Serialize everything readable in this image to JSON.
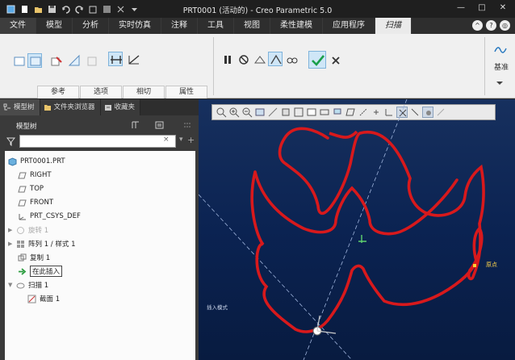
{
  "window": {
    "title": "PRT0001 (活动的) - Creo Parametric 5.0",
    "buttons": [
      "—",
      "□",
      "✕"
    ]
  },
  "ribbon_tabs": [
    "文件",
    "模型",
    "分析",
    "实时仿真",
    "注释",
    "工具",
    "视图",
    "柔性建模",
    "应用程序",
    "扫描"
  ],
  "ribbon": {
    "panel_tabs": [
      "参考",
      "选项",
      "相切",
      "属性"
    ],
    "right_label": "基准"
  },
  "left_panel": {
    "tabs": [
      "模型树",
      "文件夹浏览器",
      "收藏夹"
    ],
    "tree_label": "模型树",
    "filter": {
      "value": "",
      "placeholder": ""
    },
    "nodes": {
      "root": "PRT0001.PRT",
      "right": "RIGHT",
      "top": "TOP",
      "front": "FRONT",
      "csys": "PRT_CSYS_DEF",
      "rotate": "旋转 1",
      "pattern": "阵列 1 / 样式 1",
      "copy": "复制 1",
      "insert": "在此插入",
      "sweep": "扫描 1",
      "section": "截面 1"
    }
  },
  "viewport": {
    "start_label": "原点",
    "insert_label": "插入模式",
    "colors": {
      "curve": "#d8191c",
      "background": "#0c2450",
      "axis": "#9fb4dc"
    }
  }
}
